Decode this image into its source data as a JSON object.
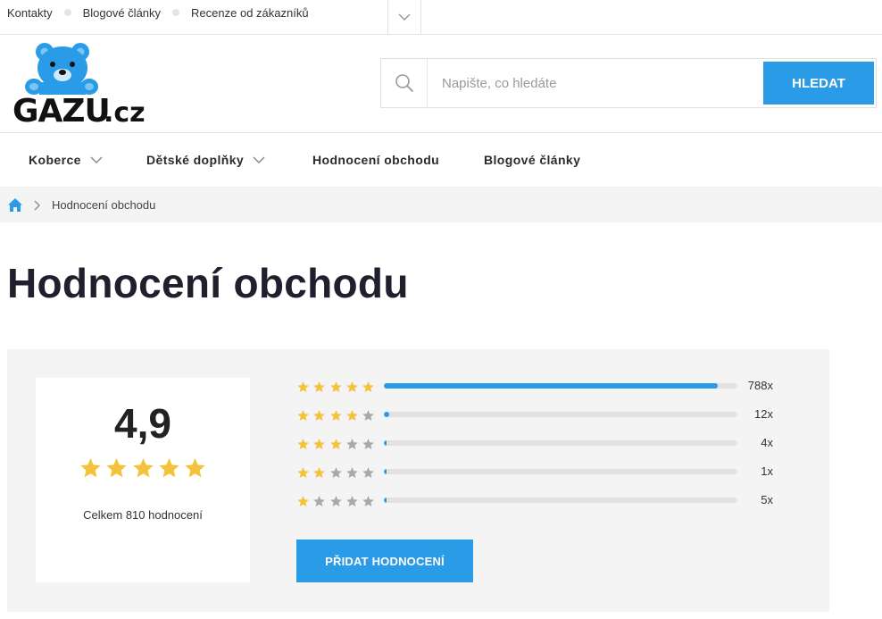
{
  "topbar": {
    "links": [
      {
        "label": "Kontakty"
      },
      {
        "label": "Blogové články"
      },
      {
        "label": "Recenze od zákazníků"
      }
    ]
  },
  "logo": {
    "text": "GAZU.cz",
    "color": "#2a9be6"
  },
  "search": {
    "placeholder": "Napište, co hledáte",
    "value": "",
    "button_label": "HLEDAT"
  },
  "nav": {
    "items": [
      {
        "label": "Koberce",
        "has_dropdown": true
      },
      {
        "label": "Dětské doplňky",
        "has_dropdown": true
      },
      {
        "label": "Hodnocení obchodu",
        "has_dropdown": false
      },
      {
        "label": "Blogové články",
        "has_dropdown": false
      }
    ]
  },
  "breadcrumb": {
    "current": "Hodnocení obchodu"
  },
  "page": {
    "title": "Hodnocení obchodu"
  },
  "rating": {
    "score": "4,9",
    "score_stars": 5,
    "total_label": "Celkem 810 hodnocení",
    "rows": [
      {
        "stars": 5,
        "count_label": "788x",
        "count": 788
      },
      {
        "stars": 4,
        "count_label": "12x",
        "count": 12
      },
      {
        "stars": 3,
        "count_label": "4x",
        "count": 4
      },
      {
        "stars": 2,
        "count_label": "1x",
        "count": 1
      },
      {
        "stars": 1,
        "count_label": "5x",
        "count": 5
      }
    ],
    "total": 810,
    "add_button_label": "PŘIDAT HODNOCENÍ"
  },
  "colors": {
    "accent": "#2a9be6",
    "star_filled": "#f5c33b",
    "star_empty": "#a9a9a9"
  }
}
